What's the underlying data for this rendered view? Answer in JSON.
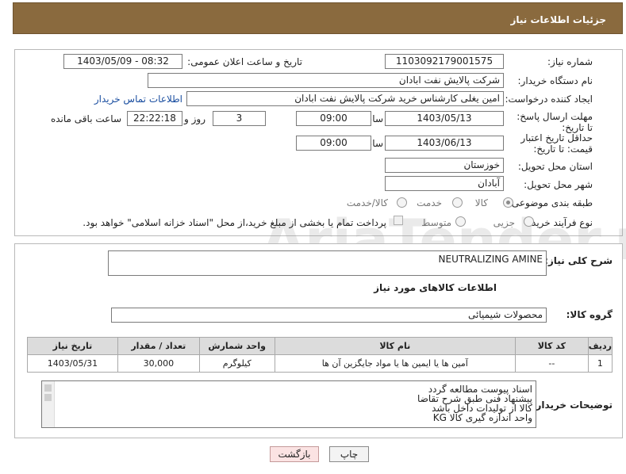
{
  "header": {
    "title": "جزئیات اطلاعات نیاز"
  },
  "form": {
    "need_number_label": "شماره نیاز:",
    "need_number_value": "1103092179001575",
    "announce_label": "تاریخ و ساعت اعلان عمومی:",
    "announce_value": "1403/05/09 - 08:32",
    "buyer_org_label": "نام دستگاه خریدار:",
    "buyer_org_value": "شرکت پالایش نفت ابادان",
    "creator_label": "ایجاد کننده درخواست:",
    "creator_value": "امین یغلی کارشناس خرید شرکت پالایش نفت ابادان",
    "contact_link": "اطلاعات تماس خریدار",
    "reply_deadline_label": "مهلت ارسال پاسخ: تا تاریخ:",
    "reply_date": "1403/05/13",
    "time_label": "ساعت",
    "reply_time": "09:00",
    "days_value": "3",
    "days_label": "روز و",
    "remaining_time": "22:22:18",
    "remaining_label": "ساعت باقی مانده",
    "price_validity_label": "حداقل تاریخ اعتبار قیمت: تا تاریخ:",
    "validity_date": "1403/06/13",
    "validity_time": "09:00",
    "province_label": "استان محل تحویل:",
    "province_value": "خوزستان",
    "city_label": "شهر محل تحویل:",
    "city_value": "آبادان",
    "category_label": "طبقه بندی موضوعی:",
    "category_options": [
      "کالا",
      "خدمت",
      "کالا/خدمت"
    ],
    "category_selected": "کالا",
    "process_label": "نوع فرآیند خرید :",
    "process_options": [
      "جزیی",
      "متوسط"
    ],
    "payment_note": "پرداخت تمام یا بخشی از مبلغ خرید،از محل \"اسناد خزانه اسلامی\" خواهد بود."
  },
  "description": {
    "label": "شرح کلی نیاز:",
    "value": "NEUTRALIZING AMINE"
  },
  "goods_info": {
    "title": "اطلاعات کالاهای مورد نیاز",
    "group_label": "گروه کالا:",
    "group_value": "محصولات شیمیائی"
  },
  "table": {
    "headers": [
      "ردیف",
      "کد کالا",
      "نام کالا",
      "واحد شمارش",
      "تعداد / مقدار",
      "تاریخ نیاز"
    ],
    "rows": [
      [
        "1",
        "--",
        "آمین ها یا ایمین ها یا مواد جایگزین آن ها",
        "کیلوگرم",
        "30,000",
        "1403/05/31"
      ]
    ]
  },
  "buyer_notes": {
    "label": "توضیحات خریدار:",
    "lines": [
      "اسناد پیوست مطالعه گردد",
      "پیشنهاد فنی طبق شرح تقاضا",
      "کالا از تولیدات داخل باشد",
      "واحد اندازه گیری کالا KG"
    ]
  },
  "buttons": {
    "print": "چاپ",
    "back": "بازگشت"
  },
  "watermark": "AriaTender.neT"
}
